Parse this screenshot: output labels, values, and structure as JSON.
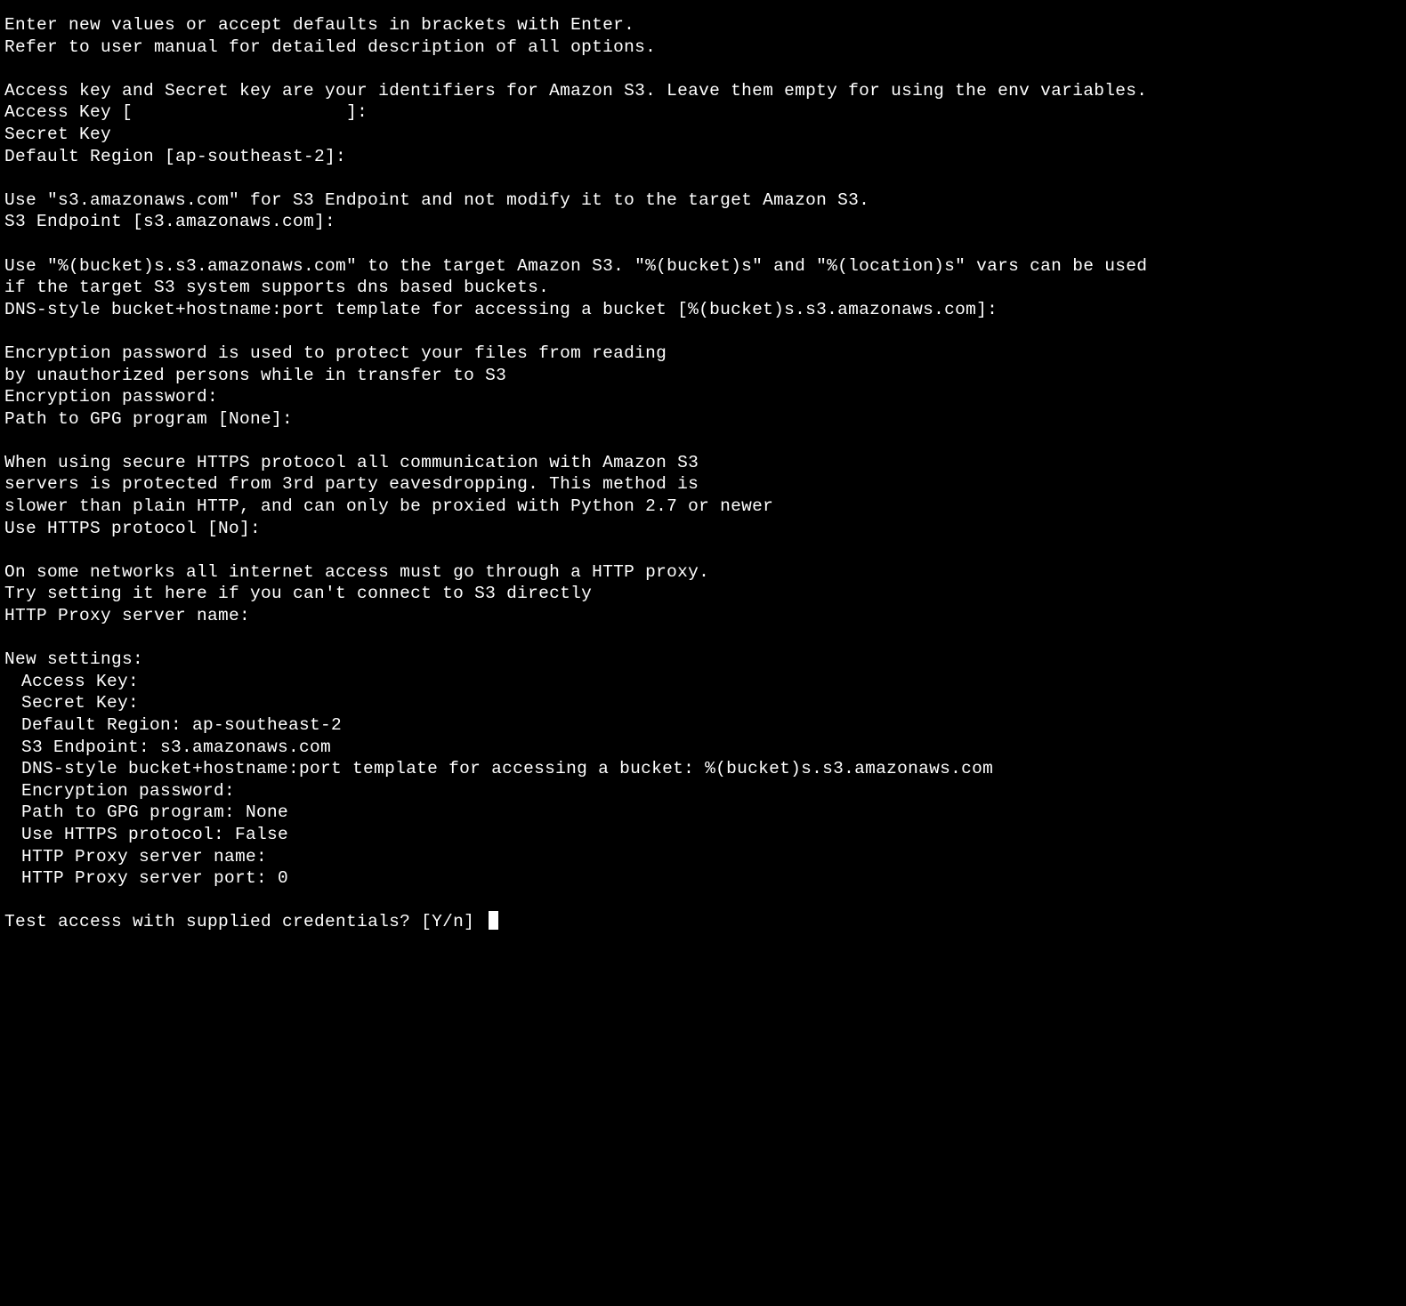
{
  "intro": {
    "l1": "Enter new values or accept defaults in brackets with Enter.",
    "l2": "Refer to user manual for detailed description of all options."
  },
  "access": {
    "desc": "Access key and Secret key are your identifiers for Amazon S3. Leave them empty for using the env variables.",
    "access_key_label": "Access Key [",
    "access_key_mask": "                    ",
    "access_key_close": "]:",
    "secret_key_label": "Secret Key",
    "region_label": "Default Region [ap-southeast-2]:"
  },
  "endpoint": {
    "desc": "Use \"s3.amazonaws.com\" for S3 Endpoint and not modify it to the target Amazon S3.",
    "label": "S3 Endpoint [s3.amazonaws.com]:"
  },
  "dns": {
    "desc1": "Use \"%(bucket)s.s3.amazonaws.com\" to the target Amazon S3. \"%(bucket)s\" and \"%(location)s\" vars can be used",
    "desc2": "if the target S3 system supports dns based buckets.",
    "label": "DNS-style bucket+hostname:port template for accessing a bucket [%(bucket)s.s3.amazonaws.com]:"
  },
  "encryption": {
    "desc1": "Encryption password is used to protect your files from reading",
    "desc2": "by unauthorized persons while in transfer to S3",
    "pw_label": "Encryption password:",
    "gpg_label": "Path to GPG program [None]:"
  },
  "https": {
    "desc1": "When using secure HTTPS protocol all communication with Amazon S3",
    "desc2": "servers is protected from 3rd party eavesdropping. This method is",
    "desc3": "slower than plain HTTP, and can only be proxied with Python 2.7 or newer",
    "label": "Use HTTPS protocol [No]:"
  },
  "proxy": {
    "desc1": "On some networks all internet access must go through a HTTP proxy.",
    "desc2": "Try setting it here if you can't connect to S3 directly",
    "label": "HTTP Proxy server name:"
  },
  "summary": {
    "header": "New settings:",
    "access_key": "Access Key: ",
    "secret_key": "Secret Key: ",
    "region": "Default Region: ap-southeast-2",
    "endpoint": "S3 Endpoint: s3.amazonaws.com",
    "dns": "DNS-style bucket+hostname:port template for accessing a bucket: %(bucket)s.s3.amazonaws.com",
    "enc": "Encryption password:",
    "gpg": "Path to GPG program: None",
    "https": "Use HTTPS protocol: False",
    "proxy_name": "HTTP Proxy server name:",
    "proxy_port": "HTTP Proxy server port: 0"
  },
  "prompt": {
    "text": "Test access with supplied credentials? [Y/n] "
  }
}
